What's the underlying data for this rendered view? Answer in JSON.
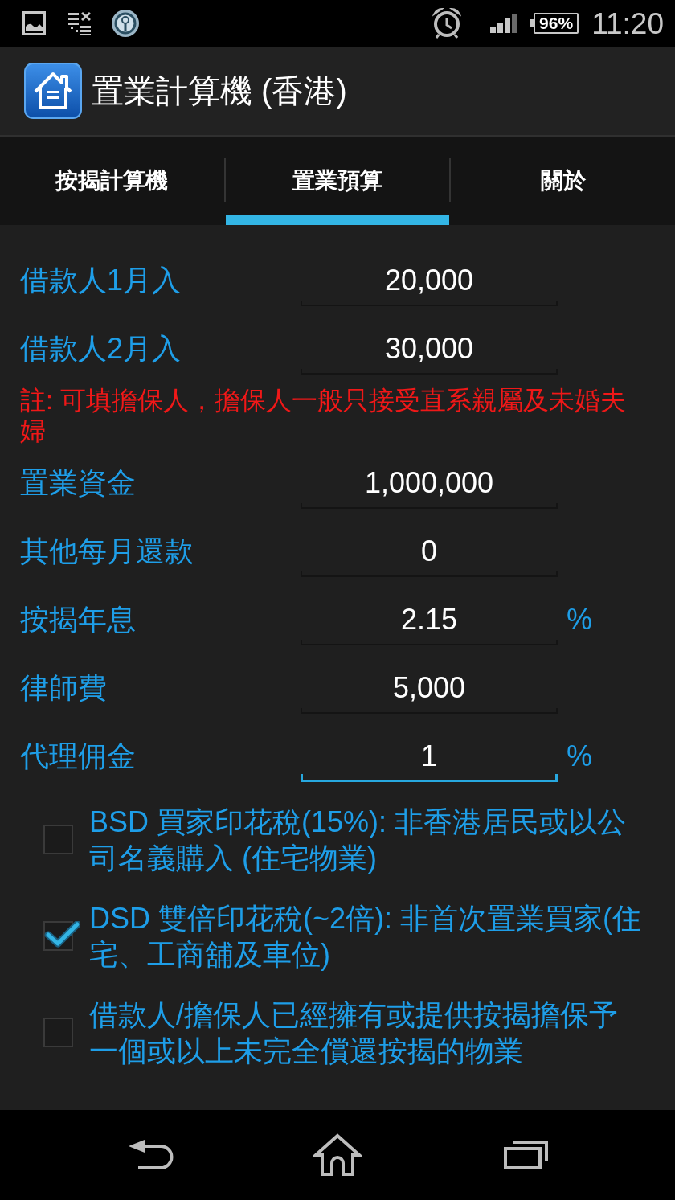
{
  "status_bar": {
    "battery": "96%",
    "time": "11:20"
  },
  "app_bar": {
    "title": "置業計算機 (香港)"
  },
  "tabs": [
    {
      "label": "按揭計算機",
      "selected": false
    },
    {
      "label": "置業預算",
      "selected": true
    },
    {
      "label": "關於",
      "selected": false
    }
  ],
  "form": {
    "rows": [
      {
        "kind": "field",
        "label": "借款人1月入",
        "value": "20,000",
        "focused": false
      },
      {
        "kind": "field",
        "label": "借款人2月入",
        "value": "30,000",
        "focused": false
      },
      {
        "kind": "note",
        "text": "註: 可填擔保人，擔保人一般只接受直系親屬及未婚夫婦"
      },
      {
        "kind": "field",
        "label": "置業資金",
        "value": "1,000,000",
        "focused": false
      },
      {
        "kind": "field",
        "label": "其他每月還款",
        "value": "0",
        "focused": false
      },
      {
        "kind": "field",
        "label": "按揭年息",
        "value": "2.15",
        "unit": "%",
        "focused": false
      },
      {
        "kind": "field",
        "label": "律師費",
        "value": "5,000",
        "focused": false
      },
      {
        "kind": "field",
        "label": "代理佣金",
        "value": "1",
        "unit": "%",
        "focused": true
      }
    ],
    "checkboxes": [
      {
        "label": "BSD 買家印花稅(15%): 非香港居民或以公司名義購入 (住宅物業)",
        "checked": false
      },
      {
        "label": "DSD 雙倍印花稅(~2倍): 非首次置業買家(住宅、工商舖及車位)",
        "checked": true
      },
      {
        "label": "借款人/擔保人已經擁有或提供按揭擔保予一個或以上未完全償還按揭的物業",
        "checked": false
      }
    ]
  }
}
